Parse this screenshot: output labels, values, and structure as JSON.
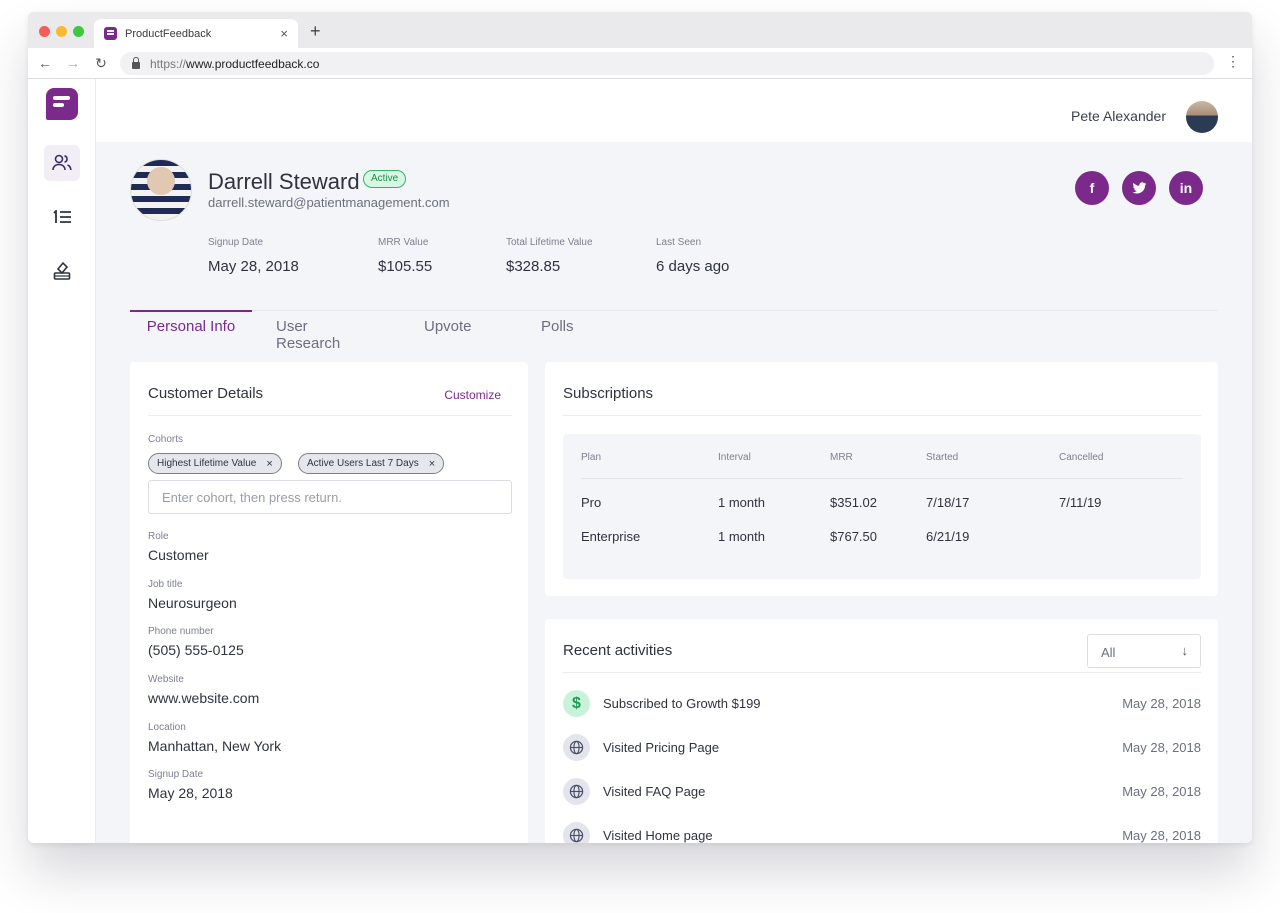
{
  "browser": {
    "tab_title": "ProductFeedback",
    "tab_close": "×",
    "new_tab": "+",
    "url_proto": "https://",
    "url_host": "www.productfeedback.co",
    "back": "←",
    "forward": "→",
    "reload": "↻",
    "menu": "⋮"
  },
  "topbar": {
    "user_name": "Pete Alexander"
  },
  "profile": {
    "name": "Darrell Steward",
    "status": "Active",
    "email": "darrell.steward@patientmanagement.com",
    "social": {
      "facebook": "f",
      "twitter": "t",
      "linkedin": "in"
    }
  },
  "stats": [
    {
      "label": "Signup Date",
      "value": "May 28, 2018"
    },
    {
      "label": "MRR Value",
      "value": "$105.55"
    },
    {
      "label": "Total Lifetime Value",
      "value": "$328.85"
    },
    {
      "label": "Last Seen",
      "value": "6 days ago"
    }
  ],
  "tabs": [
    {
      "label": "Personal Info"
    },
    {
      "label": "User Research"
    },
    {
      "label": "Upvote"
    },
    {
      "label": "Polls"
    }
  ],
  "customer": {
    "title": "Customer Details",
    "customize": "Customize",
    "cohorts_label": "Cohorts",
    "chips": [
      "Highest Lifetime Value",
      "Active Users Last 7 Days"
    ],
    "chip_remove": "×",
    "cohort_placeholder": "Enter cohort, then press return.",
    "fields": [
      {
        "label": "Role",
        "value": "Customer"
      },
      {
        "label": "Job title",
        "value": "Neurosurgeon"
      },
      {
        "label": "Phone number",
        "value": "(505) 555-0125"
      },
      {
        "label": "Website",
        "value": "www.website.com"
      },
      {
        "label": "Location",
        "value": "Manhattan, New York"
      },
      {
        "label": "Signup Date",
        "value": "May 28, 2018"
      }
    ]
  },
  "subscriptions": {
    "title": "Subscriptions",
    "headers": [
      "Plan",
      "Interval",
      "MRR",
      "Started",
      "Cancelled"
    ],
    "rows": [
      [
        "Pro",
        "1 month",
        "$351.02",
        "7/18/17",
        "7/11/19"
      ],
      [
        "Enterprise",
        "1 month",
        "$767.50",
        "6/21/19",
        ""
      ]
    ]
  },
  "activities": {
    "title": "Recent activities",
    "filter": "All",
    "filter_arrow": "↓",
    "items": [
      {
        "icon": "dollar-icon",
        "text": "Subscribed to Growth $199",
        "date": "May 28, 2018"
      },
      {
        "icon": "globe-icon",
        "text": "Visited Pricing Page",
        "date": "May 28, 2018"
      },
      {
        "icon": "globe-icon",
        "text": "Visited FAQ Page",
        "date": "May 28, 2018"
      },
      {
        "icon": "globe-icon",
        "text": "Visited Home page",
        "date": "May 28, 2018"
      }
    ]
  },
  "colors": {
    "accent": "#7b2a8c",
    "active_badge": "#34b46b",
    "money_green": "#1f9c52"
  }
}
